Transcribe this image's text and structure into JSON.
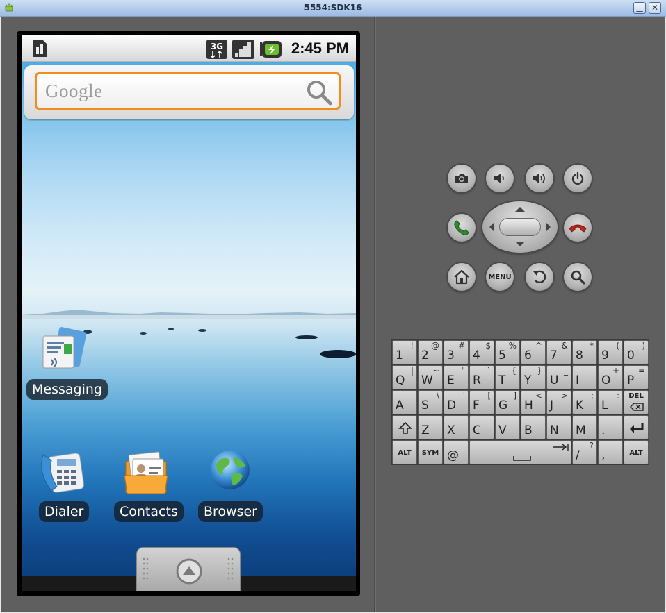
{
  "window": {
    "title": "5554:SDK16",
    "minimize_glyph": "▁",
    "close_glyph": "✕"
  },
  "statusbar": {
    "network": "3G",
    "time": "2:45 PM",
    "icons": [
      "sim-card-icon",
      "3g-icon",
      "signal-strength-icon",
      "battery-charging-icon"
    ]
  },
  "search_widget": {
    "logo": "Google",
    "icon": "search-icon"
  },
  "home_apps": [
    {
      "label": "Messaging",
      "icon": "messaging-icon"
    },
    {
      "label": "Dialer",
      "icon": "dialer-icon"
    },
    {
      "label": "Contacts",
      "icon": "contacts-icon"
    },
    {
      "label": "Browser",
      "icon": "browser-globe-icon"
    }
  ],
  "hardware_buttons": {
    "row1": [
      "camera-icon",
      "volume-down-icon",
      "volume-up-icon",
      "power-icon"
    ],
    "row2": [
      "call-icon",
      "dpad",
      "end-call-icon"
    ],
    "row3": [
      "home-icon",
      "menu-button",
      "back-icon",
      "search-icon"
    ],
    "menu_label": "MENU"
  },
  "keyboard": {
    "row1": [
      {
        "main": "1",
        "alt": "!"
      },
      {
        "main": "2",
        "alt": "@"
      },
      {
        "main": "3",
        "alt": "#"
      },
      {
        "main": "4",
        "alt": "$"
      },
      {
        "main": "5",
        "alt": "%"
      },
      {
        "main": "6",
        "alt": "^"
      },
      {
        "main": "7",
        "alt": "&"
      },
      {
        "main": "8",
        "alt": "*"
      },
      {
        "main": "9",
        "alt": "("
      },
      {
        "main": "0",
        "alt": ")"
      }
    ],
    "row2": [
      {
        "main": "Q",
        "alt": "|"
      },
      {
        "main": "W",
        "alt": "~"
      },
      {
        "main": "E",
        "alt": "\""
      },
      {
        "main": "R",
        "alt": "`"
      },
      {
        "main": "T",
        "alt": "{"
      },
      {
        "main": "Y",
        "alt": "}"
      },
      {
        "main": "U",
        "alt": "_"
      },
      {
        "main": "I",
        "alt": "-"
      },
      {
        "main": "O",
        "alt": "+"
      },
      {
        "main": "P",
        "alt": "="
      }
    ],
    "row3": [
      {
        "main": "A",
        "alt": ""
      },
      {
        "main": "S",
        "alt": "\\"
      },
      {
        "main": "D",
        "alt": "'"
      },
      {
        "main": "F",
        "alt": "["
      },
      {
        "main": "G",
        "alt": "]"
      },
      {
        "main": "H",
        "alt": "<"
      },
      {
        "main": "J",
        "alt": ">"
      },
      {
        "main": "K",
        "alt": ";"
      },
      {
        "main": "L",
        "alt": ":"
      }
    ],
    "row4": [
      {
        "main": "Z",
        "alt": ""
      },
      {
        "main": "X",
        "alt": ""
      },
      {
        "main": "C",
        "alt": ""
      },
      {
        "main": "V",
        "alt": ""
      },
      {
        "main": "B",
        "alt": ""
      },
      {
        "main": "N",
        "alt": ""
      },
      {
        "main": "M",
        "alt": ""
      },
      {
        "main": ".",
        "alt": ""
      }
    ],
    "del_label": "DEL",
    "alt_label": "ALT",
    "sym_label": "SYM",
    "at_label": "@",
    "slash": {
      "main": "/",
      "alt": "?"
    },
    "comma": ","
  },
  "colors": {
    "search_border": "#f28c1c",
    "call_green": "#2e8b2e",
    "end_call_red": "#c0241c"
  }
}
